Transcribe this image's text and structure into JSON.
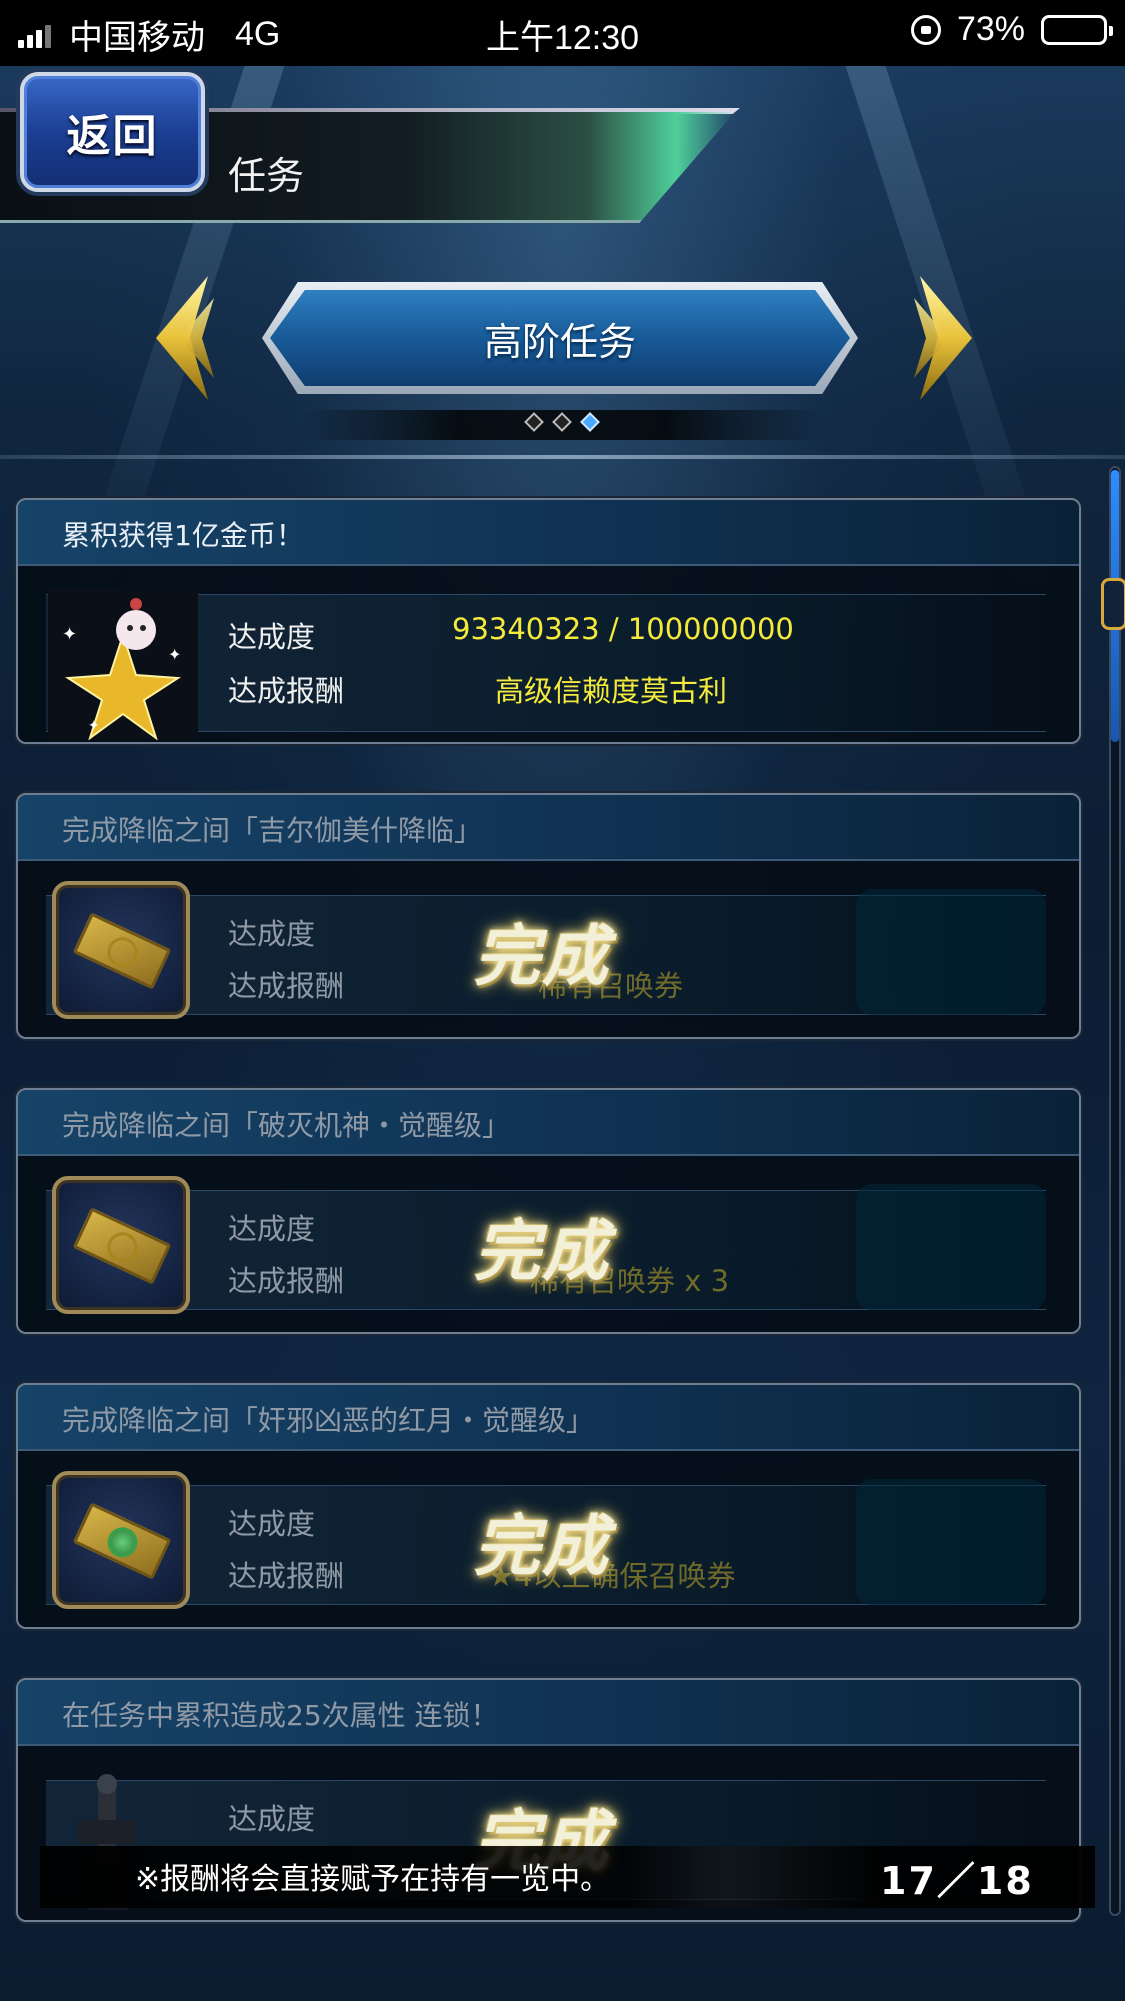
{
  "status_bar": {
    "carrier": "中国移动",
    "network": "4G",
    "time": "上午12:30",
    "battery": "73%",
    "battery_level": 0.73
  },
  "header": {
    "back_label": "返回",
    "title": "任务"
  },
  "category": {
    "label": "高阶任务",
    "page_count": 3,
    "active_page": 3
  },
  "missions": [
    {
      "title": "累积获得1亿金币！",
      "progress_label": "达成度",
      "progress_value": "93340323  /  100000000",
      "reward_label": "达成报酬",
      "reward_value": "高级信赖度莫古利",
      "icon": "moogle-star-icon",
      "completed": false
    },
    {
      "title": "完成降临之间「吉尔伽美什降临」",
      "progress_label": "达成度",
      "reward_label": "达成报酬",
      "reward_value": "稀有召唤券",
      "complete_label": "完成",
      "icon": "summon-ticket-icon",
      "completed": true
    },
    {
      "title": "完成降临之间「破灭机神・觉醒级」",
      "progress_label": "达成度",
      "reward_label": "达成报酬",
      "reward_value": "稀有召唤券 x 3",
      "complete_label": "完成",
      "icon": "summon-ticket-icon",
      "completed": true
    },
    {
      "title": "完成降临之间「奸邪凶恶的红月・觉醒级」",
      "progress_label": "达成度",
      "reward_label": "达成报酬",
      "reward_value": "★4以上确保召唤券",
      "complete_label": "完成",
      "icon": "guaranteed-ticket-icon",
      "completed": true
    },
    {
      "title": "在任务中累积造成25次属性 连锁！",
      "progress_label": "达成度",
      "complete_label": "完成",
      "icon": "character-icon",
      "completed": true
    }
  ],
  "footer": {
    "note": "※报酬将会直接赋予在持有一览中。",
    "count": "17／18"
  },
  "colors": {
    "accent_yellow": "#f4ea3c",
    "header_green": "#4fcf9a",
    "back_blue": "#1b3f93"
  }
}
